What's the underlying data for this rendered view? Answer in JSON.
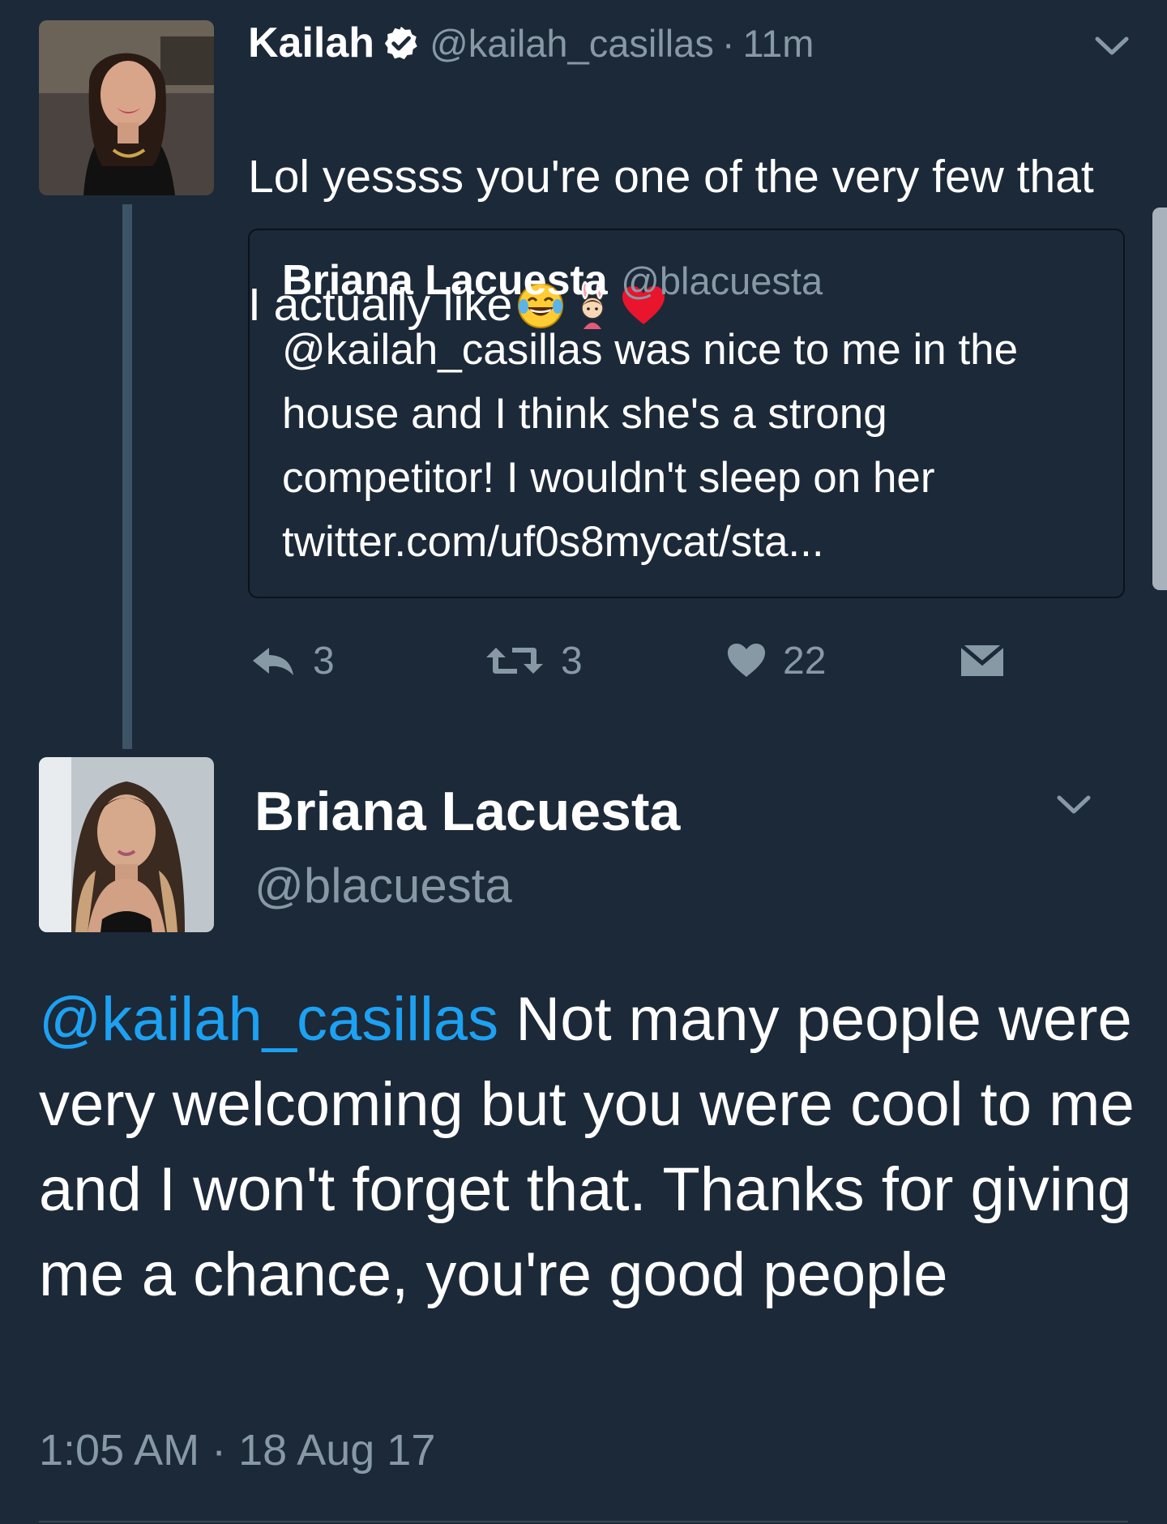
{
  "tweet1": {
    "author_name": "Kailah",
    "verified_icon": "verified-badge-icon",
    "handle": "@kailah_casillas",
    "separator": "·",
    "time": "11m",
    "text_line1": "Lol yessss you're one of the very few that",
    "text_line2": "I actually like",
    "emojis": [
      "tears-of-joy-emoji",
      "bunny-girl-emoji",
      "red-heart-emoji"
    ],
    "quoted": {
      "author_name": "Briana Lacuesta",
      "handle": "@blacuesta",
      "text": "@kailah_casillas was nice to me in the house and I think she's a strong competitor! I wouldn't sleep on her twitter.com/uf0s8mycat/sta..."
    },
    "actions": {
      "reply_count": "3",
      "retweet_count": "3",
      "like_count": "22"
    }
  },
  "tweet2": {
    "author_name": "Briana Lacuesta",
    "handle": "@blacuesta",
    "mention": "@kailah_casillas",
    "text": " Not many people were very welcoming but you were cool to me and I won't forget that. Thanks for giving me a chance, you're good people",
    "timestamp": "1:05 AM · 18 Aug 17"
  },
  "colors": {
    "background": "#1c2938",
    "secondary_text": "#8899a6",
    "link": "#1da1f2",
    "thread_line": "#3d5466"
  }
}
